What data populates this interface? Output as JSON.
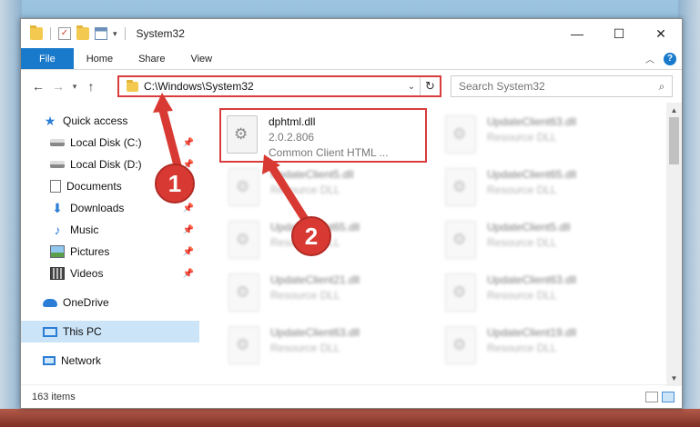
{
  "window": {
    "title": "System32",
    "controls": {
      "minimize": "—",
      "maximize": "☐",
      "close": "✕"
    }
  },
  "ribbon": {
    "tabs": [
      "File",
      "Home",
      "Share",
      "View"
    ],
    "collapse_icon": "chevron-up-icon",
    "help_label": "?"
  },
  "address_bar": {
    "path": "C:\\Windows\\System32",
    "search_placeholder": "Search System32"
  },
  "navigation": {
    "quick_access": "Quick access",
    "pinned": [
      "Local Disk (C:)",
      "Local Disk (D:)",
      "Documents",
      "Downloads",
      "Music",
      "Pictures",
      "Videos"
    ],
    "onedrive": "OneDrive",
    "this_pc": "This PC",
    "network": "Network"
  },
  "files": [
    {
      "name": "dphtml.dll",
      "line2": "2.0.2.806",
      "line3": "Common Client HTML ..."
    },
    {
      "name": "UpdateClient63.dll",
      "line2": "Resource DLL"
    },
    {
      "name": "UpdateClient5.dll",
      "line2": "Resource DLL"
    },
    {
      "name": "UpdateClient65.dll",
      "line2": "Resource DLL"
    },
    {
      "name": "UpdateClient65.dll",
      "line2": "Resource DLL"
    },
    {
      "name": "UpdateClient5.dll",
      "line2": "Resource DLL"
    },
    {
      "name": "UpdateClient21.dll",
      "line2": "Resource DLL"
    },
    {
      "name": "UpdateClient63.dll",
      "line2": "Resource DLL"
    },
    {
      "name": "UpdateClient63.dll",
      "line2": "Resource DLL"
    },
    {
      "name": "UpdateClient19.dll",
      "line2": "Resource DLL"
    }
  ],
  "status": {
    "item_count": "163 items"
  },
  "callouts": [
    "1",
    "2"
  ],
  "colors": {
    "accent": "#1979ca",
    "highlight": "#d93c3c",
    "selection": "#cce4f7"
  }
}
